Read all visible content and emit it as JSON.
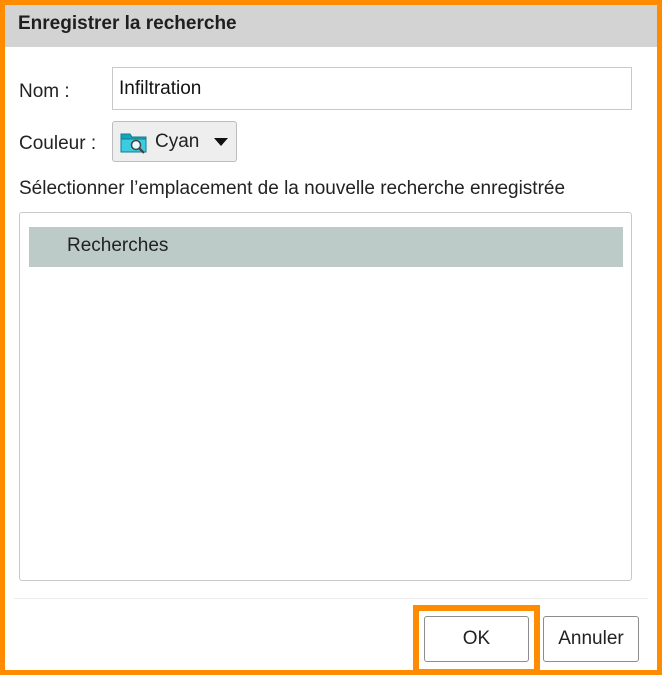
{
  "dialog": {
    "title": "Enregistrer la recherche"
  },
  "form": {
    "name_label": "Nom :",
    "name_value": "Infiltration",
    "color_label": "Couleur :",
    "color_value": "Cyan",
    "color_icon": "folder-search-icon",
    "color_hex": "#22b8cf",
    "location_instruction": "Sélectionner l’emplacement de la nouvelle recherche enregistrée"
  },
  "tree": {
    "items": [
      {
        "label": "Recherches",
        "selected": true
      }
    ]
  },
  "buttons": {
    "ok_label": "OK",
    "cancel_label": "Annuler"
  },
  "colors": {
    "highlight": "#ff8c00",
    "selected_row": "#bccac8",
    "titlebar": "#d3d3d3"
  }
}
